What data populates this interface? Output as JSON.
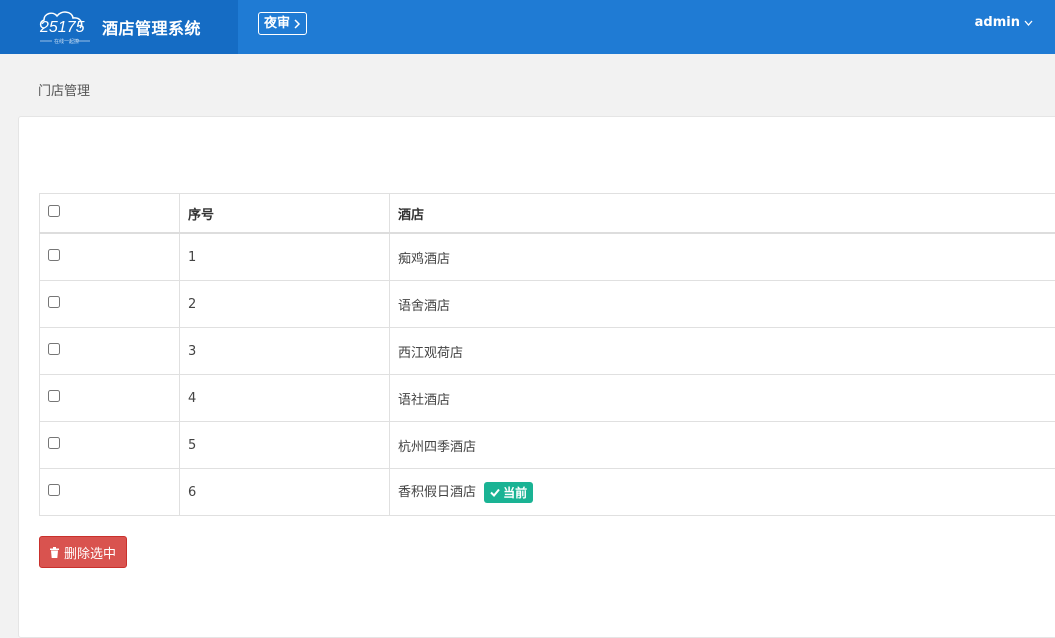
{
  "header": {
    "logo_text": "25175",
    "logo_sub": "在线一起撩",
    "app_title": "酒店管理系统",
    "night_audit_label": "夜审",
    "user_name": "admin"
  },
  "breadcrumb": "门店管理",
  "table": {
    "headers": {
      "seq": "序号",
      "hotel": "酒店"
    },
    "rows": [
      {
        "seq": "1",
        "hotel": "痴鸡酒店"
      },
      {
        "seq": "2",
        "hotel": "语舍酒店"
      },
      {
        "seq": "3",
        "hotel": "西江观荷店"
      },
      {
        "seq": "4",
        "hotel": "语社酒店"
      },
      {
        "seq": "5",
        "hotel": "杭州四季酒店"
      },
      {
        "seq": "6",
        "hotel": "香积假日酒店",
        "badge": "当前"
      }
    ]
  },
  "actions": {
    "delete_selected_label": "删除选中"
  },
  "colors": {
    "header_bg": "#1f7bd4",
    "brand_bg": "#156cc4",
    "badge": "#1ab394",
    "danger": "#d9534f"
  }
}
